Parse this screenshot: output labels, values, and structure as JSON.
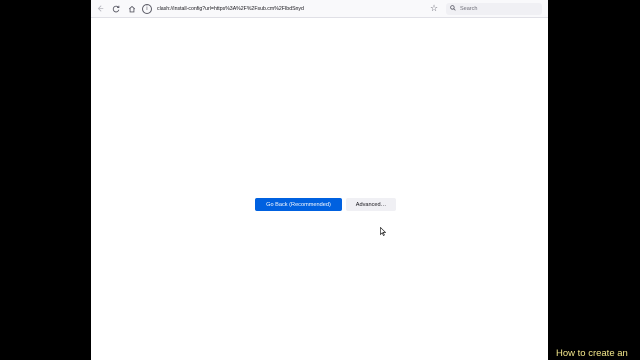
{
  "browser": {
    "url": "clash://install-config?url=https%3A%2F%2Fsub.cm%2FIbdSnyd",
    "search_placeholder": "Search",
    "icons": {
      "back": "back-arrow-icon",
      "forward": "forward-arrow-icon",
      "reload": "reload-icon",
      "home": "home-icon",
      "info": "info-icon",
      "bookmark": "star-icon",
      "search": "search-icon"
    }
  },
  "page": {
    "primary_button": "Go Back (Recommended)",
    "secondary_button": "Advanced…",
    "colors": {
      "primary": "#0061e0",
      "secondary": "#f0f0f4"
    }
  },
  "caption": {
    "text": "How to create  an"
  }
}
